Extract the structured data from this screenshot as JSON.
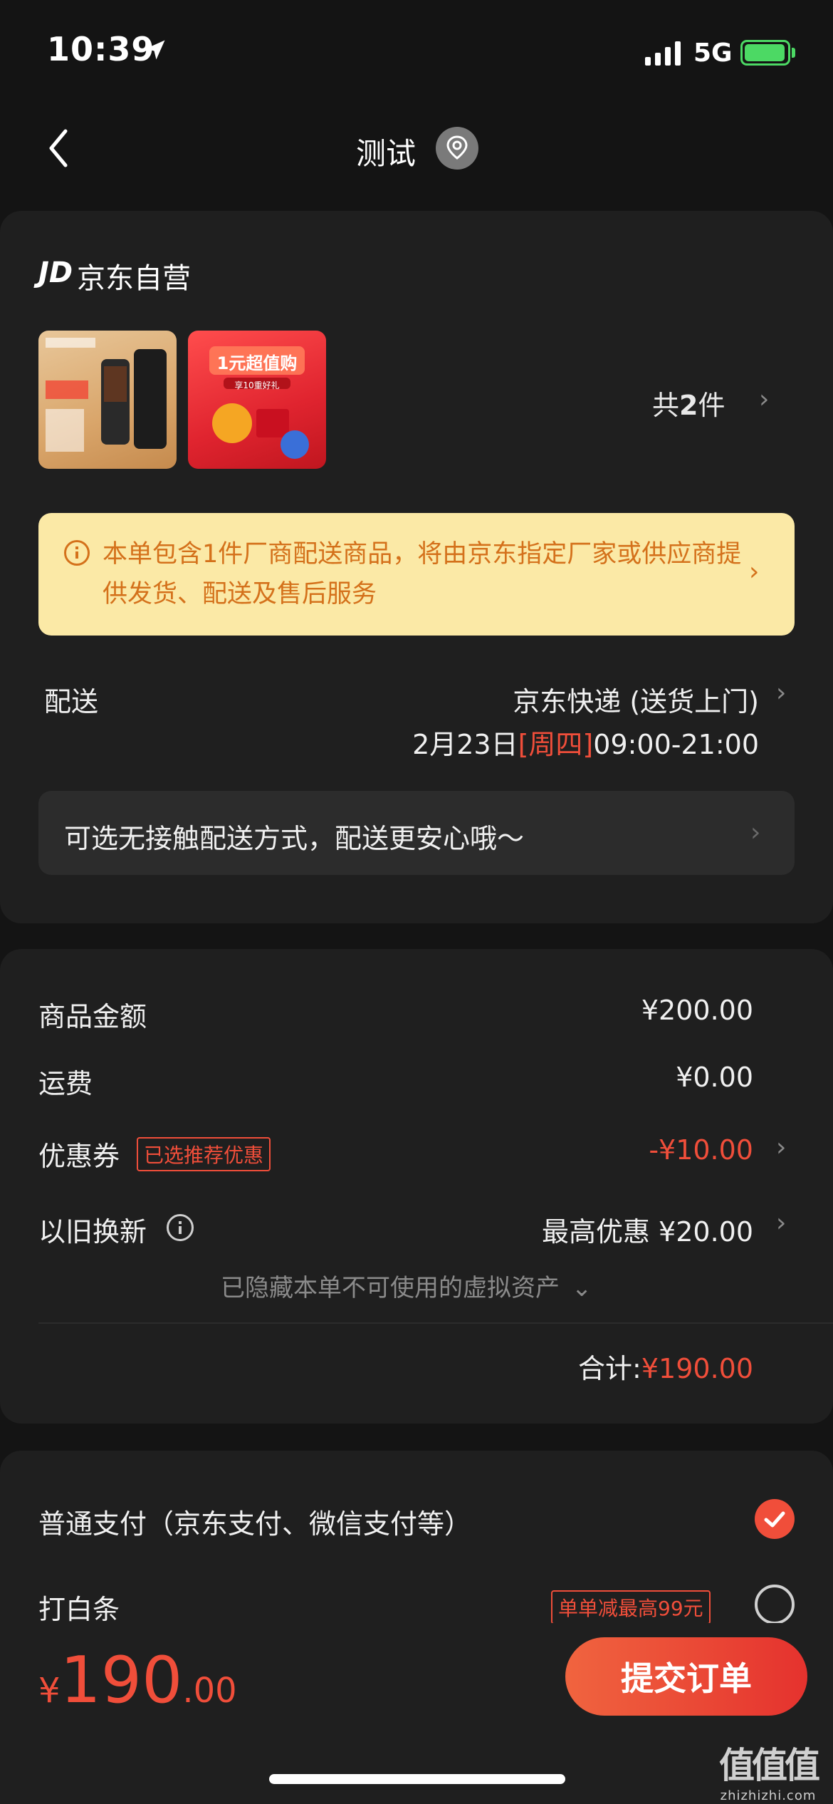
{
  "status": {
    "time": "10:39",
    "network": "5G"
  },
  "nav": {
    "title": "测试"
  },
  "shop": {
    "logo": "JD",
    "name": "京东自营"
  },
  "items": {
    "count_prefix": "共",
    "count": "2",
    "count_suffix": "件",
    "thumbs": [
      {
        "title": "1元超值购",
        "sub": "享10重好礼"
      }
    ]
  },
  "notice": {
    "text": "本单包含1件厂商配送商品，将由京东指定厂家或供应商提供发货、配送及售后服务"
  },
  "delivery": {
    "label": "配送",
    "method": "京东快递 (送货上门)",
    "date": "2月23日",
    "weekday": "[周四]",
    "time": "09:00-21:00",
    "contactless": "可选无接触配送方式，配送更安心哦～"
  },
  "summary": {
    "goods_label": "商品金额",
    "goods_value": "¥200.00",
    "shipping_label": "运费",
    "shipping_value": "¥0.00",
    "coupon_label": "优惠券",
    "coupon_tag": "已选推荐优惠",
    "coupon_value": "-¥10.00",
    "tradein_label": "以旧换新",
    "tradein_value": "最高优惠 ¥20.00",
    "hidden_assets": "已隐藏本单不可使用的虚拟资产",
    "total_label": "合计:",
    "total_value": "¥190.00"
  },
  "payment": {
    "normal": "普通支付（京东支付、微信支付等）",
    "baitiao": "打白条",
    "baitiao_tag": "单单减最高99元"
  },
  "footer": {
    "currency": "¥",
    "amount_int": "190",
    "amount_dec": ".00",
    "submit": "提交订单"
  },
  "watermark": {
    "big": "值值值",
    "small": "zhizhizhi.com"
  },
  "colors": {
    "accent": "#f04e3a",
    "notice_bg": "#fbe9a6",
    "notice_text": "#d4711b"
  }
}
